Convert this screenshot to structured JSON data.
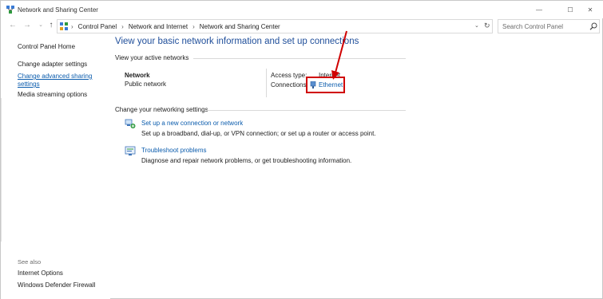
{
  "window": {
    "title": "Network and Sharing Center",
    "controls": {
      "minimize": "—",
      "maximize": "☐",
      "close": "✕"
    }
  },
  "navigation": {
    "back": "←",
    "forward": "→",
    "recent": "⌄",
    "up": "↑",
    "breadcrumbs": [
      "Control Panel",
      "Network and Internet",
      "Network and Sharing Center"
    ],
    "separator": "›",
    "dropdown": "⌄",
    "refresh": "↻"
  },
  "search": {
    "placeholder": "Search Control Panel"
  },
  "sidebar": {
    "links": [
      {
        "label": "Control Panel Home"
      },
      {
        "label": "Change adapter settings"
      },
      {
        "label": "Change advanced sharing settings"
      },
      {
        "label": "Media streaming options"
      }
    ],
    "see_also_label": "See also",
    "see_also": [
      {
        "label": "Internet Options"
      },
      {
        "label": "Windows Defender Firewall"
      }
    ]
  },
  "main": {
    "heading": "View your basic network information and set up connections",
    "active_networks": {
      "title": "View your active networks",
      "network_name": "Network",
      "network_type": "Public network",
      "access_type_label": "Access type:",
      "access_type_value": "Internet",
      "connections_label": "Connections:",
      "connection_link": "Ethernet"
    },
    "settings": {
      "title": "Change your networking settings",
      "tasks": [
        {
          "link": "Set up a new connection or network",
          "description": "Set up a broadband, dial-up, or VPN connection; or set up a router or access point."
        },
        {
          "link": "Troubleshoot problems",
          "description": "Diagnose and repair network problems, or get troubleshooting information."
        }
      ]
    }
  },
  "annotation": {
    "highlight_color": "#d00000"
  },
  "colors": {
    "link": "#0b5cad",
    "heading": "#1f4e9a"
  }
}
